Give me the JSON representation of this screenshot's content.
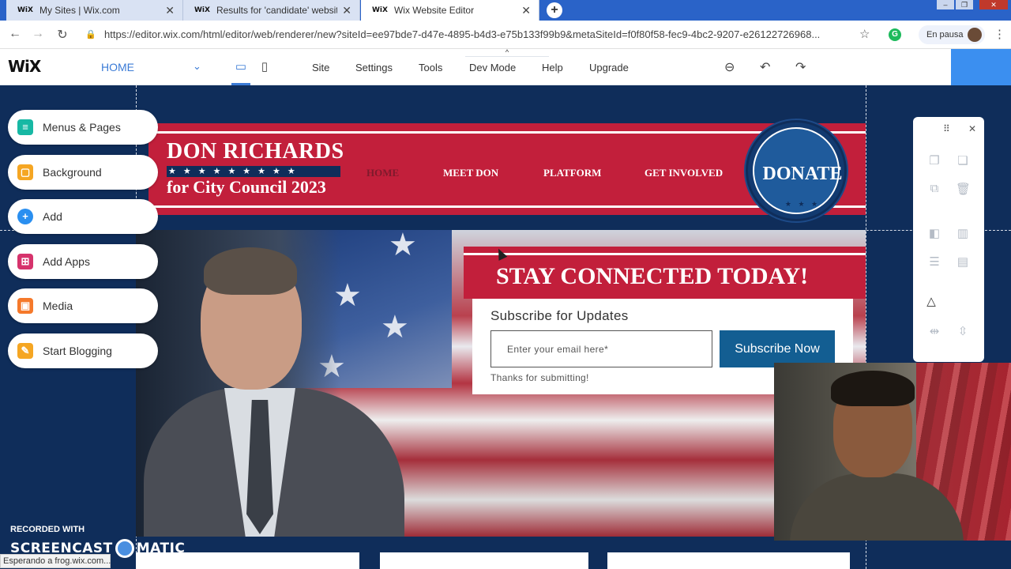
{
  "browser": {
    "tabs": [
      {
        "favicon": "WiX",
        "title": "My Sites | Wix.com"
      },
      {
        "favicon": "WiX",
        "title": "Results for 'candidate' website te"
      },
      {
        "favicon": "WiX",
        "title": "Wix Website Editor"
      }
    ],
    "new_tab": "+",
    "url": "https://editor.wix.com/html/editor/web/renderer/new?siteId=ee97bde7-d47e-4895-b4d3-e75b133f99b9&metaSiteId=f0f80f58-fec9-4bc2-9207-e26122726968...",
    "profile_label": "En pausa",
    "status": "Esperando a frog.wix.com..."
  },
  "editor": {
    "logo": "WiX",
    "page_select": "HOME",
    "menu": [
      "Site",
      "Settings",
      "Tools",
      "Dev Mode",
      "Help",
      "Upgrade"
    ]
  },
  "left_panel": [
    {
      "label": "Menus & Pages",
      "icon": "pages-icon",
      "color": "#17b8a4"
    },
    {
      "label": "Background",
      "icon": "background-icon",
      "color": "#f5a623"
    },
    {
      "label": "Add",
      "icon": "add-icon",
      "color": "#2a8ff0"
    },
    {
      "label": "Add Apps",
      "icon": "apps-icon",
      "color": "#d6336c"
    },
    {
      "label": "Media",
      "icon": "media-icon",
      "color": "#f5792b"
    },
    {
      "label": "Start Blogging",
      "icon": "blog-icon",
      "color": "#f5a623"
    }
  ],
  "site": {
    "candidate_name": "DON RICHARDS",
    "stars": "★★★★★★★★★",
    "subtitle": "for City Council 2023",
    "nav": [
      "HOME",
      "MEET DON",
      "PLATFORM",
      "GET INVOLVED"
    ],
    "donate": "DONATE",
    "donate_stars": "★ ★ ★",
    "stay_connected": "STAY CONNECTED TODAY!",
    "subscribe_heading": "Subscribe for Updates",
    "email_placeholder": "Enter your email here*",
    "subscribe_button": "Subscribe Now",
    "thanks": "Thanks for submitting!",
    "colors": {
      "primary_red": "#c21f3b",
      "navy": "#0f2d5a",
      "button_blue": "#135e92"
    }
  },
  "watermark": {
    "line1": "RECORDED WITH",
    "line2a": "SCREENCAST",
    "line2b": "MATIC"
  }
}
